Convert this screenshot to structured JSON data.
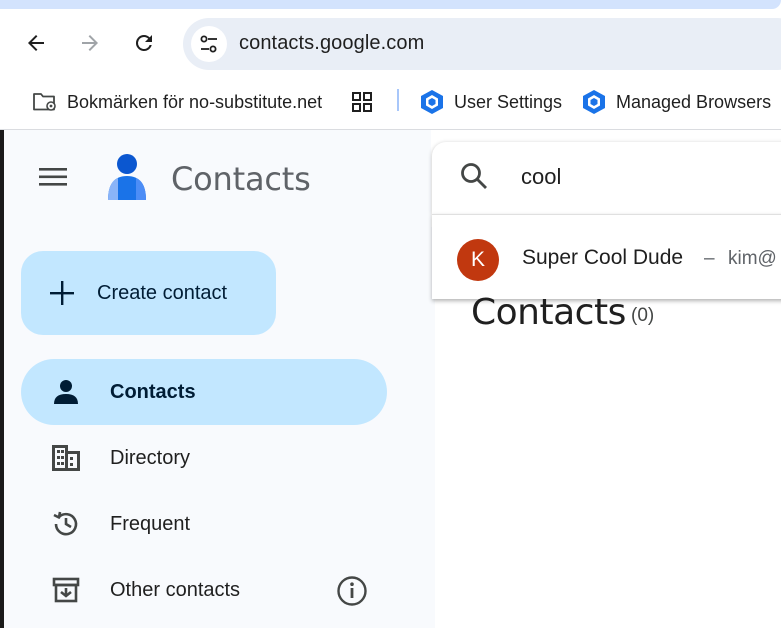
{
  "browser": {
    "url": "contacts.google.com",
    "bookmarks": [
      {
        "label": "Bokmärken för no-substitute.net",
        "icon": "folder-managed-icon"
      },
      {
        "label": "User Settings",
        "icon": "hexagon-icon"
      },
      {
        "label": "Managed Browsers",
        "icon": "hexagon-icon"
      }
    ]
  },
  "app": {
    "title": "Contacts"
  },
  "sidebar": {
    "create_label": "Create contact",
    "items": [
      {
        "label": "Contacts",
        "icon": "person-icon",
        "active": true
      },
      {
        "label": "Directory",
        "icon": "building-icon",
        "active": false
      },
      {
        "label": "Frequent",
        "icon": "history-icon",
        "active": false
      },
      {
        "label": "Other contacts",
        "icon": "archive-icon",
        "active": false
      }
    ]
  },
  "search": {
    "query": "cool",
    "suggestion": {
      "initial": "K",
      "name": "Super Cool Dude",
      "separator": "–",
      "email": "kim@"
    }
  },
  "main": {
    "title": "Contacts",
    "count": "(0)"
  },
  "colors": {
    "active_nav": "#c2e7ff",
    "avatar": "#c1380f",
    "sidebar_bg": "#f8fafd"
  }
}
